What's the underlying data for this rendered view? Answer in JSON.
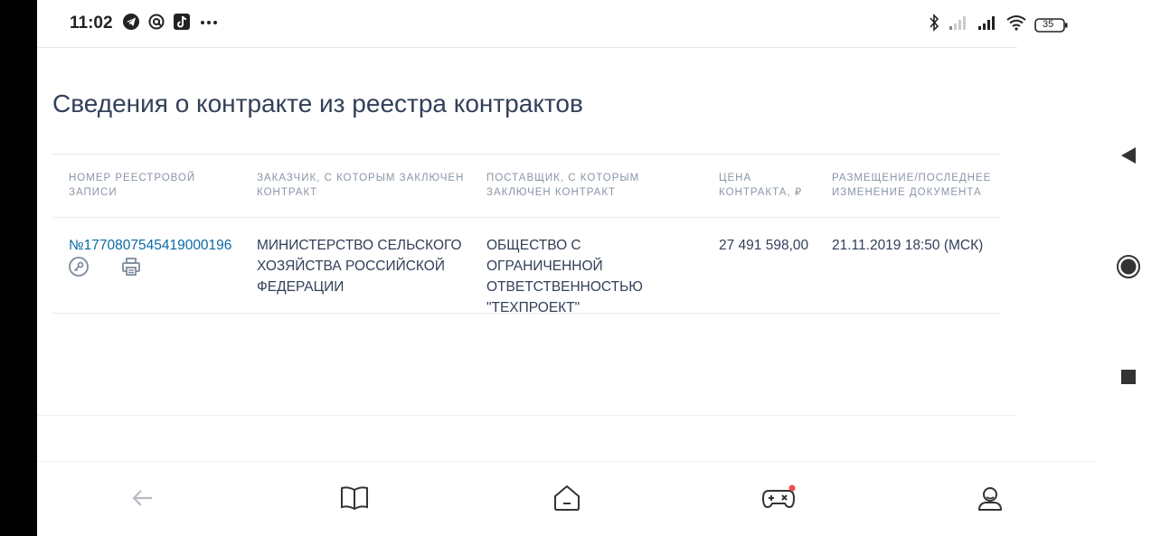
{
  "status_bar": {
    "time": "11:02",
    "left_icons": [
      "telegram-icon",
      "at-sign-icon",
      "tiktok-icon",
      "more-dots-icon"
    ],
    "right_icons": [
      "bluetooth-icon",
      "signal-weak-icon",
      "signal-strong-icon",
      "wifi-icon",
      "battery-icon"
    ],
    "battery_level": "35"
  },
  "page": {
    "title": "Сведения о контракте из реестра контрактов"
  },
  "table": {
    "headers": [
      "НОМЕР РЕЕСТРОВОЙ ЗАПИСИ",
      "ЗАКАЗЧИК, С КОТОРЫМ ЗАКЛЮЧЕН КОНТРАКТ",
      "ПОСТАВЩИК, С КОТОРЫМ ЗАКЛЮЧЕН КОНТРАКТ",
      "ЦЕНА КОНТРАКТА, ₽",
      "РАЗМЕЩЕНИЕ/ПОСЛЕДНЕЕ ИЗМЕНЕНИЕ ДОКУМЕНТА"
    ],
    "rows": [
      {
        "registry_number": "№1770807545419000196",
        "customer": "МИНИСТЕРСТВО СЕЛЬСКОГО ХОЗЯЙСТВА РОССИЙСКОЙ ФЕДЕРАЦИИ",
        "supplier": "ОБЩЕСТВО С ОГРАНИЧЕННОЙ ОТВЕТСТВЕННОСТЬЮ \"ТЕХПРОЕКТ\"",
        "price": "27 491 598,00",
        "date": "21.11.2019 18:50 (МСК)"
      }
    ]
  },
  "bottom_nav": {
    "items": [
      "back-arrow-icon",
      "book-icon",
      "home-icon",
      "gamepad-icon",
      "profile-icon"
    ],
    "accent": "#f04a4a"
  },
  "system_nav": {
    "items": [
      "system-back-icon",
      "system-home-icon",
      "system-recents-icon"
    ]
  },
  "colors": {
    "link": "#0b6aa5",
    "text": "#334059",
    "header_text": "#8a96a6",
    "icon": "#4a5568"
  }
}
